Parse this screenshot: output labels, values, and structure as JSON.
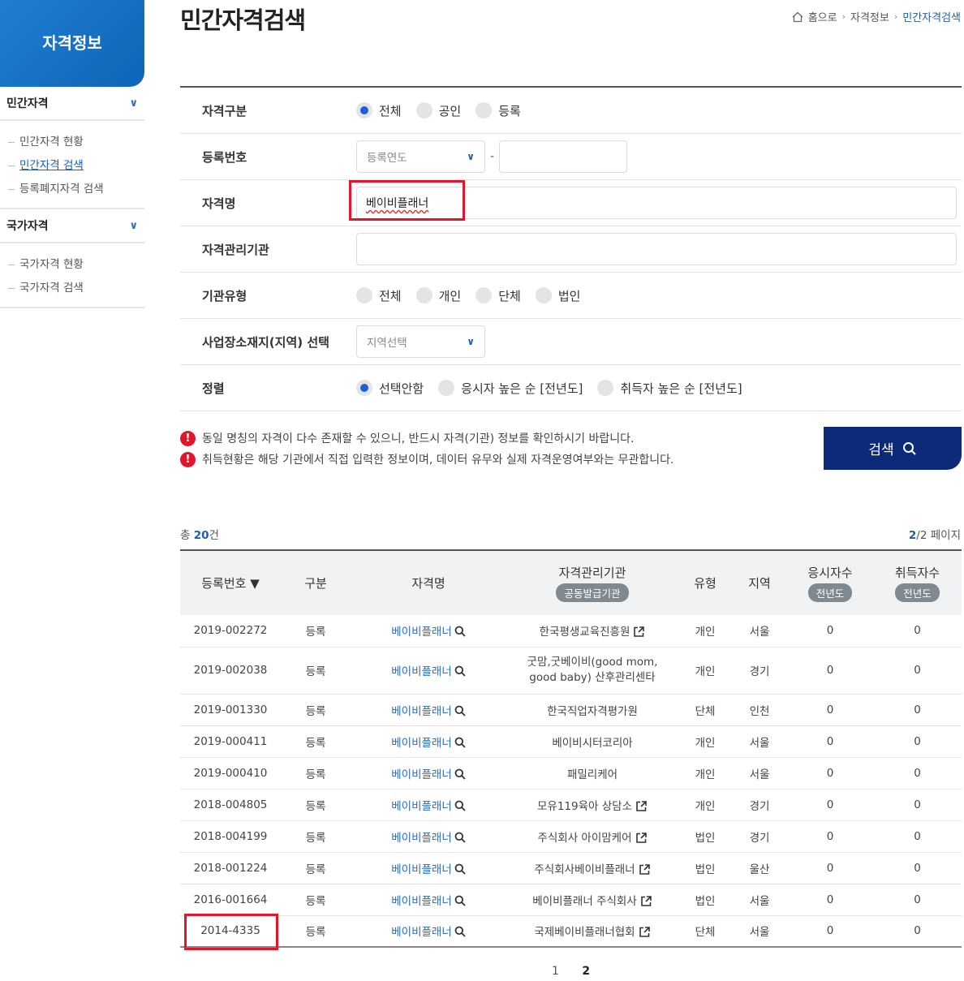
{
  "sidebar": {
    "title": "자격정보",
    "sections": [
      {
        "label": "민간자격",
        "items": [
          "민간자격 현황",
          "민간자격 검색",
          "등록폐지자격 검색"
        ],
        "active": 1
      },
      {
        "label": "국가자격",
        "items": [
          "국가자격 현황",
          "국가자격 검색"
        ],
        "active": -1
      }
    ]
  },
  "header": {
    "title": "민간자격검색",
    "breadcrumb": [
      "홈으로",
      "자격정보",
      "민간자격검색"
    ]
  },
  "form": {
    "qual_type_label": "자격구분",
    "qual_type_options": [
      "전체",
      "공인",
      "등록"
    ],
    "reg_no_label": "등록번호",
    "reg_year_placeholder": "등록연도",
    "reg_dash": "-",
    "qual_name_label": "자격명",
    "qual_name_value": "베이비플래너",
    "org_label": "자격관리기관",
    "org_value": "",
    "org_type_label": "기관유형",
    "org_type_options": [
      "전체",
      "개인",
      "단체",
      "법인"
    ],
    "region_label": "사업장소재지(지역) 선택",
    "region_placeholder": "지역선택",
    "sort_label": "정렬",
    "sort_options": [
      "선택안함",
      "응시자 높은 순 [전년도]",
      "취득자 높은 순 [전년도]"
    ]
  },
  "notes": [
    "동일 명칭의 자격이 다수 존재할 수 있으니, 반드시 자격(기관) 정보를 확인하시기 바랍니다.",
    "취득현황은 해당 기관에서 직접 입력한 정보이며, 데이터 유무와 실제 자격운영여부와는 무관합니다."
  ],
  "search_button": "검색",
  "summary": {
    "total_prefix": "총 ",
    "total_count": "20",
    "total_suffix": "건",
    "page_current": "2",
    "page_total": "/2 페이지"
  },
  "table": {
    "headers": {
      "reg_no": "등록번호 ▼",
      "type": "구분",
      "name": "자격명",
      "org": "자격관리기관",
      "org_sub": "공동발급기관",
      "org_type": "유형",
      "region": "지역",
      "applicants": "응시자수",
      "applicants_sub": "전년도",
      "acquirers": "취득자수",
      "acquirers_sub": "전년도"
    },
    "rows": [
      {
        "reg_no": "2019-002272",
        "type": "등록",
        "name": "베이비플래너",
        "org": "한국평생교육진흥원",
        "ext": true,
        "org_type": "개인",
        "region": "서울",
        "applicants": "0",
        "acquirers": "0"
      },
      {
        "reg_no": "2019-002038",
        "type": "등록",
        "name": "베이비플래너",
        "org": "굿맘,굿베이비(good mom, good baby) 산후관리센타",
        "ext": false,
        "org_type": "개인",
        "region": "경기",
        "applicants": "0",
        "acquirers": "0"
      },
      {
        "reg_no": "2019-001330",
        "type": "등록",
        "name": "베이비플래너",
        "org": "한국직업자격평가원",
        "ext": false,
        "org_type": "단체",
        "region": "인천",
        "applicants": "0",
        "acquirers": "0"
      },
      {
        "reg_no": "2019-000411",
        "type": "등록",
        "name": "베이비플래너",
        "org": "베이비시터코리아",
        "ext": false,
        "org_type": "개인",
        "region": "서울",
        "applicants": "0",
        "acquirers": "0"
      },
      {
        "reg_no": "2019-000410",
        "type": "등록",
        "name": "베이비플래너",
        "org": "패밀리케어",
        "ext": false,
        "org_type": "개인",
        "region": "서울",
        "applicants": "0",
        "acquirers": "0"
      },
      {
        "reg_no": "2018-004805",
        "type": "등록",
        "name": "베이비플래너",
        "org": "모유119육아 상담소",
        "ext": true,
        "org_type": "개인",
        "region": "경기",
        "applicants": "0",
        "acquirers": "0"
      },
      {
        "reg_no": "2018-004199",
        "type": "등록",
        "name": "베이비플래너",
        "org": "주식회사 아이맘케어",
        "ext": true,
        "org_type": "법인",
        "region": "경기",
        "applicants": "0",
        "acquirers": "0"
      },
      {
        "reg_no": "2018-001224",
        "type": "등록",
        "name": "베이비플래너",
        "org": "주식회사베이비플래너",
        "ext": true,
        "org_type": "법인",
        "region": "울산",
        "applicants": "0",
        "acquirers": "0"
      },
      {
        "reg_no": "2016-001664",
        "type": "등록",
        "name": "베이비플래너",
        "org": "베이비플래너 주식회사",
        "ext": true,
        "org_type": "법인",
        "region": "서울",
        "applicants": "0",
        "acquirers": "0"
      },
      {
        "reg_no": "2014-4335",
        "type": "등록",
        "name": "베이비플래너",
        "org": "국제베이비플래너협회",
        "ext": true,
        "org_type": "단체",
        "region": "서울",
        "applicants": "0",
        "acquirers": "0"
      }
    ]
  },
  "pagination": [
    "1",
    "2"
  ],
  "pagination_current": "2"
}
